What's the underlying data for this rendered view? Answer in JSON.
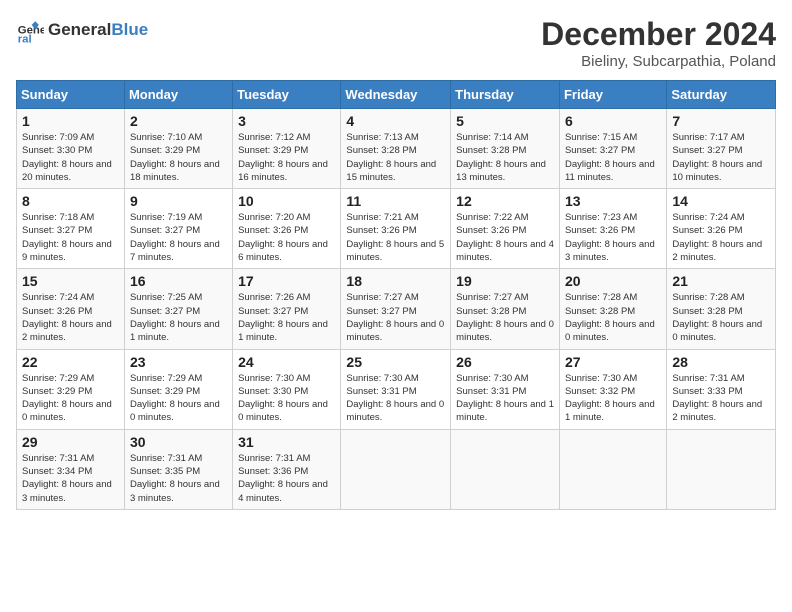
{
  "logo": {
    "general": "General",
    "blue": "Blue"
  },
  "title": "December 2024",
  "location": "Bieliny, Subcarpathia, Poland",
  "days_of_week": [
    "Sunday",
    "Monday",
    "Tuesday",
    "Wednesday",
    "Thursday",
    "Friday",
    "Saturday"
  ],
  "weeks": [
    [
      {
        "day": "1",
        "sunrise": "7:09 AM",
        "sunset": "3:30 PM",
        "daylight": "8 hours and 20 minutes."
      },
      {
        "day": "2",
        "sunrise": "7:10 AM",
        "sunset": "3:29 PM",
        "daylight": "8 hours and 18 minutes."
      },
      {
        "day": "3",
        "sunrise": "7:12 AM",
        "sunset": "3:29 PM",
        "daylight": "8 hours and 16 minutes."
      },
      {
        "day": "4",
        "sunrise": "7:13 AM",
        "sunset": "3:28 PM",
        "daylight": "8 hours and 15 minutes."
      },
      {
        "day": "5",
        "sunrise": "7:14 AM",
        "sunset": "3:28 PM",
        "daylight": "8 hours and 13 minutes."
      },
      {
        "day": "6",
        "sunrise": "7:15 AM",
        "sunset": "3:27 PM",
        "daylight": "8 hours and 11 minutes."
      },
      {
        "day": "7",
        "sunrise": "7:17 AM",
        "sunset": "3:27 PM",
        "daylight": "8 hours and 10 minutes."
      }
    ],
    [
      {
        "day": "8",
        "sunrise": "7:18 AM",
        "sunset": "3:27 PM",
        "daylight": "8 hours and 9 minutes."
      },
      {
        "day": "9",
        "sunrise": "7:19 AM",
        "sunset": "3:27 PM",
        "daylight": "8 hours and 7 minutes."
      },
      {
        "day": "10",
        "sunrise": "7:20 AM",
        "sunset": "3:26 PM",
        "daylight": "8 hours and 6 minutes."
      },
      {
        "day": "11",
        "sunrise": "7:21 AM",
        "sunset": "3:26 PM",
        "daylight": "8 hours and 5 minutes."
      },
      {
        "day": "12",
        "sunrise": "7:22 AM",
        "sunset": "3:26 PM",
        "daylight": "8 hours and 4 minutes."
      },
      {
        "day": "13",
        "sunrise": "7:23 AM",
        "sunset": "3:26 PM",
        "daylight": "8 hours and 3 minutes."
      },
      {
        "day": "14",
        "sunrise": "7:24 AM",
        "sunset": "3:26 PM",
        "daylight": "8 hours and 2 minutes."
      }
    ],
    [
      {
        "day": "15",
        "sunrise": "7:24 AM",
        "sunset": "3:26 PM",
        "daylight": "8 hours and 2 minutes."
      },
      {
        "day": "16",
        "sunrise": "7:25 AM",
        "sunset": "3:27 PM",
        "daylight": "8 hours and 1 minute."
      },
      {
        "day": "17",
        "sunrise": "7:26 AM",
        "sunset": "3:27 PM",
        "daylight": "8 hours and 1 minute."
      },
      {
        "day": "18",
        "sunrise": "7:27 AM",
        "sunset": "3:27 PM",
        "daylight": "8 hours and 0 minutes."
      },
      {
        "day": "19",
        "sunrise": "7:27 AM",
        "sunset": "3:28 PM",
        "daylight": "8 hours and 0 minutes."
      },
      {
        "day": "20",
        "sunrise": "7:28 AM",
        "sunset": "3:28 PM",
        "daylight": "8 hours and 0 minutes."
      },
      {
        "day": "21",
        "sunrise": "7:28 AM",
        "sunset": "3:28 PM",
        "daylight": "8 hours and 0 minutes."
      }
    ],
    [
      {
        "day": "22",
        "sunrise": "7:29 AM",
        "sunset": "3:29 PM",
        "daylight": "8 hours and 0 minutes."
      },
      {
        "day": "23",
        "sunrise": "7:29 AM",
        "sunset": "3:29 PM",
        "daylight": "8 hours and 0 minutes."
      },
      {
        "day": "24",
        "sunrise": "7:30 AM",
        "sunset": "3:30 PM",
        "daylight": "8 hours and 0 minutes."
      },
      {
        "day": "25",
        "sunrise": "7:30 AM",
        "sunset": "3:31 PM",
        "daylight": "8 hours and 0 minutes."
      },
      {
        "day": "26",
        "sunrise": "7:30 AM",
        "sunset": "3:31 PM",
        "daylight": "8 hours and 1 minute."
      },
      {
        "day": "27",
        "sunrise": "7:30 AM",
        "sunset": "3:32 PM",
        "daylight": "8 hours and 1 minute."
      },
      {
        "day": "28",
        "sunrise": "7:31 AM",
        "sunset": "3:33 PM",
        "daylight": "8 hours and 2 minutes."
      }
    ],
    [
      {
        "day": "29",
        "sunrise": "7:31 AM",
        "sunset": "3:34 PM",
        "daylight": "8 hours and 3 minutes."
      },
      {
        "day": "30",
        "sunrise": "7:31 AM",
        "sunset": "3:35 PM",
        "daylight": "8 hours and 3 minutes."
      },
      {
        "day": "31",
        "sunrise": "7:31 AM",
        "sunset": "3:36 PM",
        "daylight": "8 hours and 4 minutes."
      },
      null,
      null,
      null,
      null
    ]
  ],
  "labels": {
    "sunrise": "Sunrise:",
    "sunset": "Sunset:",
    "daylight": "Daylight:"
  }
}
